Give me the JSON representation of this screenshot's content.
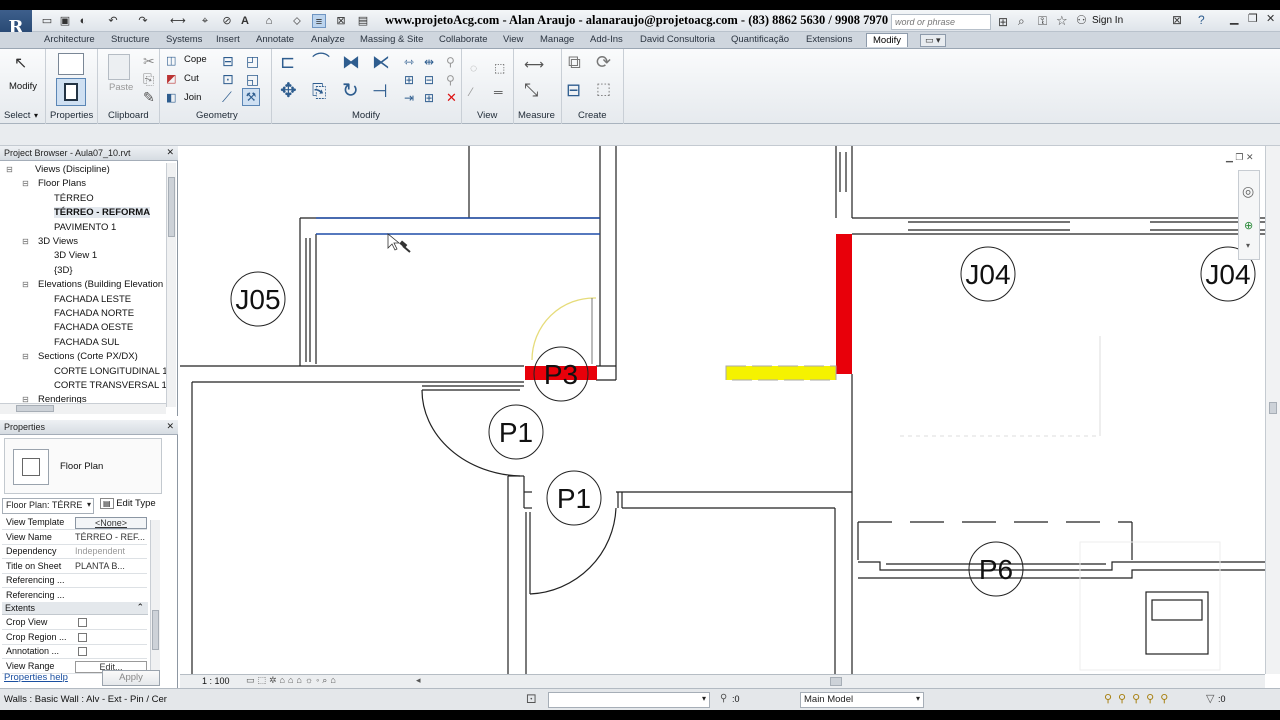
{
  "window": {
    "title": "www.projetoAcg.com - Alan Araujo - alanaraujo@projetoacg.com - (83) 8862 5630 / 9908 7970",
    "search_placeholder": "word or phrase",
    "sign_in": "Sign In",
    "app_logo": "R"
  },
  "tabs": [
    "Architecture",
    "Structure",
    "Systems",
    "Insert",
    "Annotate",
    "Analyze",
    "Massing & Site",
    "Collaborate",
    "View",
    "Manage",
    "Add-Ins",
    "David Consultoria",
    "Quantificação",
    "Extensions",
    "Modify"
  ],
  "active_tab": "Modify",
  "ribbon": {
    "modify_label": "Modify",
    "properties_label": "Properties",
    "paste_label": "Paste",
    "cope_label": "Cope",
    "cut_label": "Cut",
    "join_label": "Join",
    "panels": {
      "select": "Select",
      "properties": "Properties",
      "clipboard": "Clipboard",
      "geometry": "Geometry",
      "modify": "Modify",
      "view": "View",
      "measure": "Measure",
      "create": "Create"
    }
  },
  "project_browser": {
    "title": "Project Browser - Aula07_10.rvt",
    "items": [
      {
        "label": "Views (Discipline)",
        "level": 0
      },
      {
        "label": "Floor Plans",
        "level": 1
      },
      {
        "label": "TÉRREO",
        "level": 2
      },
      {
        "label": "TÉRREO - REFORMA",
        "level": 2,
        "selected": true
      },
      {
        "label": "PAVIMENTO 1",
        "level": 2
      },
      {
        "label": "3D Views",
        "level": 1
      },
      {
        "label": "3D View 1",
        "level": 2
      },
      {
        "label": "{3D}",
        "level": 2
      },
      {
        "label": "Elevations (Building Elevation",
        "level": 1
      },
      {
        "label": "FACHADA LESTE",
        "level": 2
      },
      {
        "label": "FACHADA NORTE",
        "level": 2
      },
      {
        "label": "FACHADA OESTE",
        "level": 2
      },
      {
        "label": "FACHADA SUL",
        "level": 2
      },
      {
        "label": "Sections (Corte PX/DX)",
        "level": 1
      },
      {
        "label": "CORTE LONGITUDINAL 1",
        "level": 2
      },
      {
        "label": "CORTE TRANSVERSAL 1",
        "level": 2
      },
      {
        "label": "Renderings",
        "level": 1
      }
    ]
  },
  "properties": {
    "title": "Properties",
    "type_name": "Floor Plan",
    "selector": "Floor Plan: TÉRRE",
    "edit_type": "Edit Type",
    "rows": [
      {
        "key": "View Template",
        "value": "<None>"
      },
      {
        "key": "View Name",
        "value": "TÉRREO - REF..."
      },
      {
        "key": "Dependency",
        "value": "Independent"
      },
      {
        "key": "Title on Sheet",
        "value": "PLANTA B..."
      },
      {
        "key": "Referencing ...",
        "value": ""
      },
      {
        "key": "Referencing ...",
        "value": ""
      }
    ],
    "section": "Extents",
    "extents_rows": [
      {
        "key": "Crop View",
        "value": ""
      },
      {
        "key": "Crop Region ...",
        "value": ""
      },
      {
        "key": "Annotation ...",
        "value": ""
      },
      {
        "key": "View Range",
        "value": "Edit..."
      }
    ],
    "help_link": "Properties help",
    "apply_label": "Apply"
  },
  "canvas": {
    "tags": [
      "J05",
      "J04",
      "J04",
      "P3",
      "P1",
      "P1",
      "P6"
    ],
    "highlight_colors": {
      "red": "#e8000a",
      "yellow": "#f5f200",
      "door_arc": "#e6dc7a"
    }
  },
  "view_control": {
    "scale": "1 : 100"
  },
  "status": {
    "text": "Walls : Basic Wall : Alv - Ext - Pin / Cer",
    "sel_count": ":0",
    "model": "Main Model",
    "filter_count": ":0"
  }
}
